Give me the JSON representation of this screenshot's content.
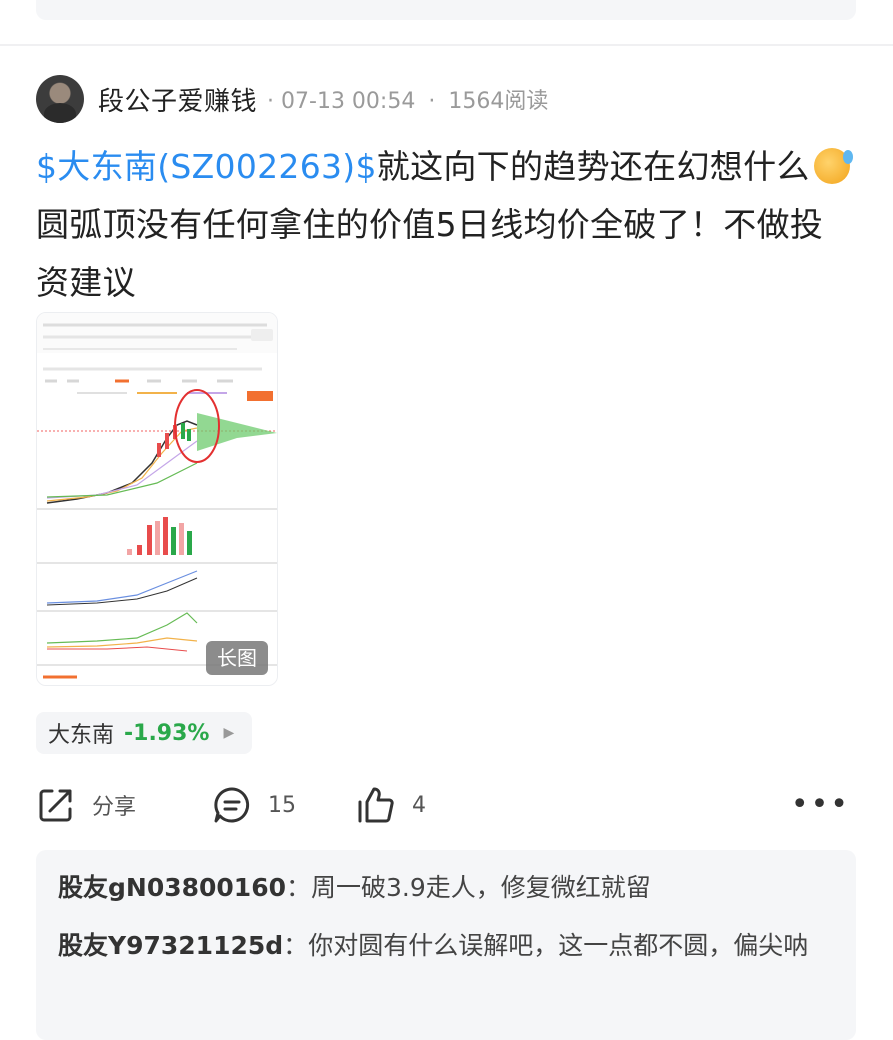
{
  "post": {
    "author": "段公子爱赚钱",
    "date": "07-13 00:54",
    "separator": "·",
    "reads": "1564阅读",
    "stock_tag": "$大东南(SZ002263)$",
    "text_part1": "就这向下的趋势还在幻想什么",
    "text_part2": "圆弧顶没有任何拿住的价值5日线均价全破了！不做投资建议",
    "emoji_icon": "worried-face-emoji",
    "image_badge": "长图"
  },
  "stock_chip": {
    "name": "大东南",
    "change": "-1.93%",
    "change_color": "#2aa84a"
  },
  "actions": {
    "share_label": "分享",
    "comments_count": "15",
    "likes_count": "4",
    "more_icon": "more-dots-icon"
  },
  "comments": [
    {
      "user": "股友gN03800160",
      "colon": "：",
      "text": "周一破3.9走人，修复微红就留"
    },
    {
      "user": "股友Y97321125d",
      "colon": "：",
      "text": "你对圆有什么误解吧，这一点都不圆，偏尖呐"
    }
  ],
  "colors": {
    "link_blue": "#2a8cf0",
    "down_green": "#2aa84a",
    "meta_gray": "#9a9a9a"
  }
}
